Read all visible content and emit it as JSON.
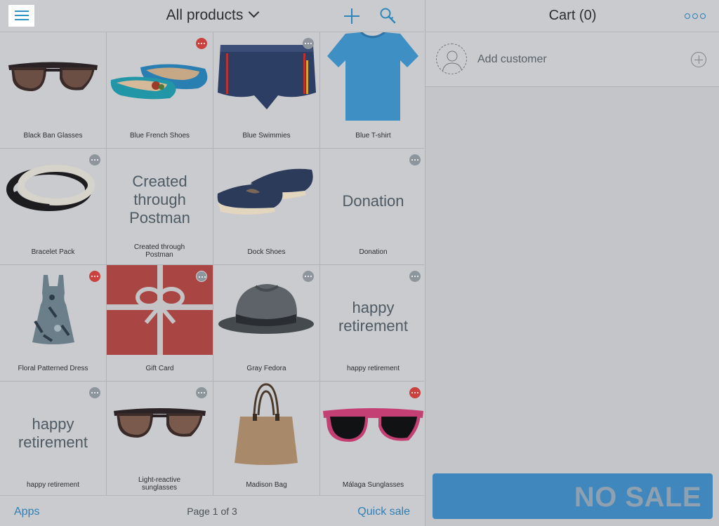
{
  "header": {
    "title": "All products",
    "menu_icon": "hamburger-icon",
    "add_icon": "plus-icon",
    "search_icon": "search-icon"
  },
  "products": [
    {
      "name": "Black Ban Glasses",
      "menu": "none",
      "image": "sunglasses-black"
    },
    {
      "name": "Blue French Shoes",
      "menu": "red",
      "image": "flats-blue"
    },
    {
      "name": "Blue Swimmies",
      "menu": "gray",
      "image": "swim-shorts"
    },
    {
      "name": "Blue T-shirt",
      "menu": "none",
      "image": "tshirt-blue"
    },
    {
      "name": "Bracelet Pack",
      "menu": "gray",
      "image": "bracelets"
    },
    {
      "name": "Created through Postman",
      "menu": "none",
      "placeholder": "Created through Postman"
    },
    {
      "name": "Dock Shoes",
      "menu": "none",
      "image": "boat-shoes"
    },
    {
      "name": "Donation",
      "menu": "gray",
      "placeholder": "Donation"
    },
    {
      "name": "Floral Patterned Dress",
      "menu": "red",
      "image": "dress"
    },
    {
      "name": "Gift Card",
      "menu": "gray",
      "image": "gift-card"
    },
    {
      "name": "Gray Fedora",
      "menu": "gray",
      "image": "fedora"
    },
    {
      "name": "happy retirement",
      "menu": "gray",
      "placeholder": "happy retirement"
    },
    {
      "name": "happy retirement",
      "menu": "gray",
      "placeholder": "happy retirement"
    },
    {
      "name": "Light-reactive sunglasses",
      "menu": "gray",
      "image": "sunglasses-brown"
    },
    {
      "name": "Madison Bag",
      "menu": "none",
      "image": "tote-bag"
    },
    {
      "name": "Málaga Sunglasses",
      "menu": "red",
      "image": "sunglasses-pink"
    }
  ],
  "footer": {
    "apps_label": "Apps",
    "page_indicator": "Page 1 of 3",
    "quick_sale_label": "Quick sale"
  },
  "cart": {
    "title": "Cart (0)",
    "more_icon": "more-options-icon",
    "add_customer_label": "Add customer",
    "no_sale_label": "NO SALE"
  },
  "colors": {
    "accent": "#2f86bb",
    "badge_red": "#c9423e",
    "badge_gray": "#8e969d",
    "no_sale_bg": "#3f87bd"
  }
}
